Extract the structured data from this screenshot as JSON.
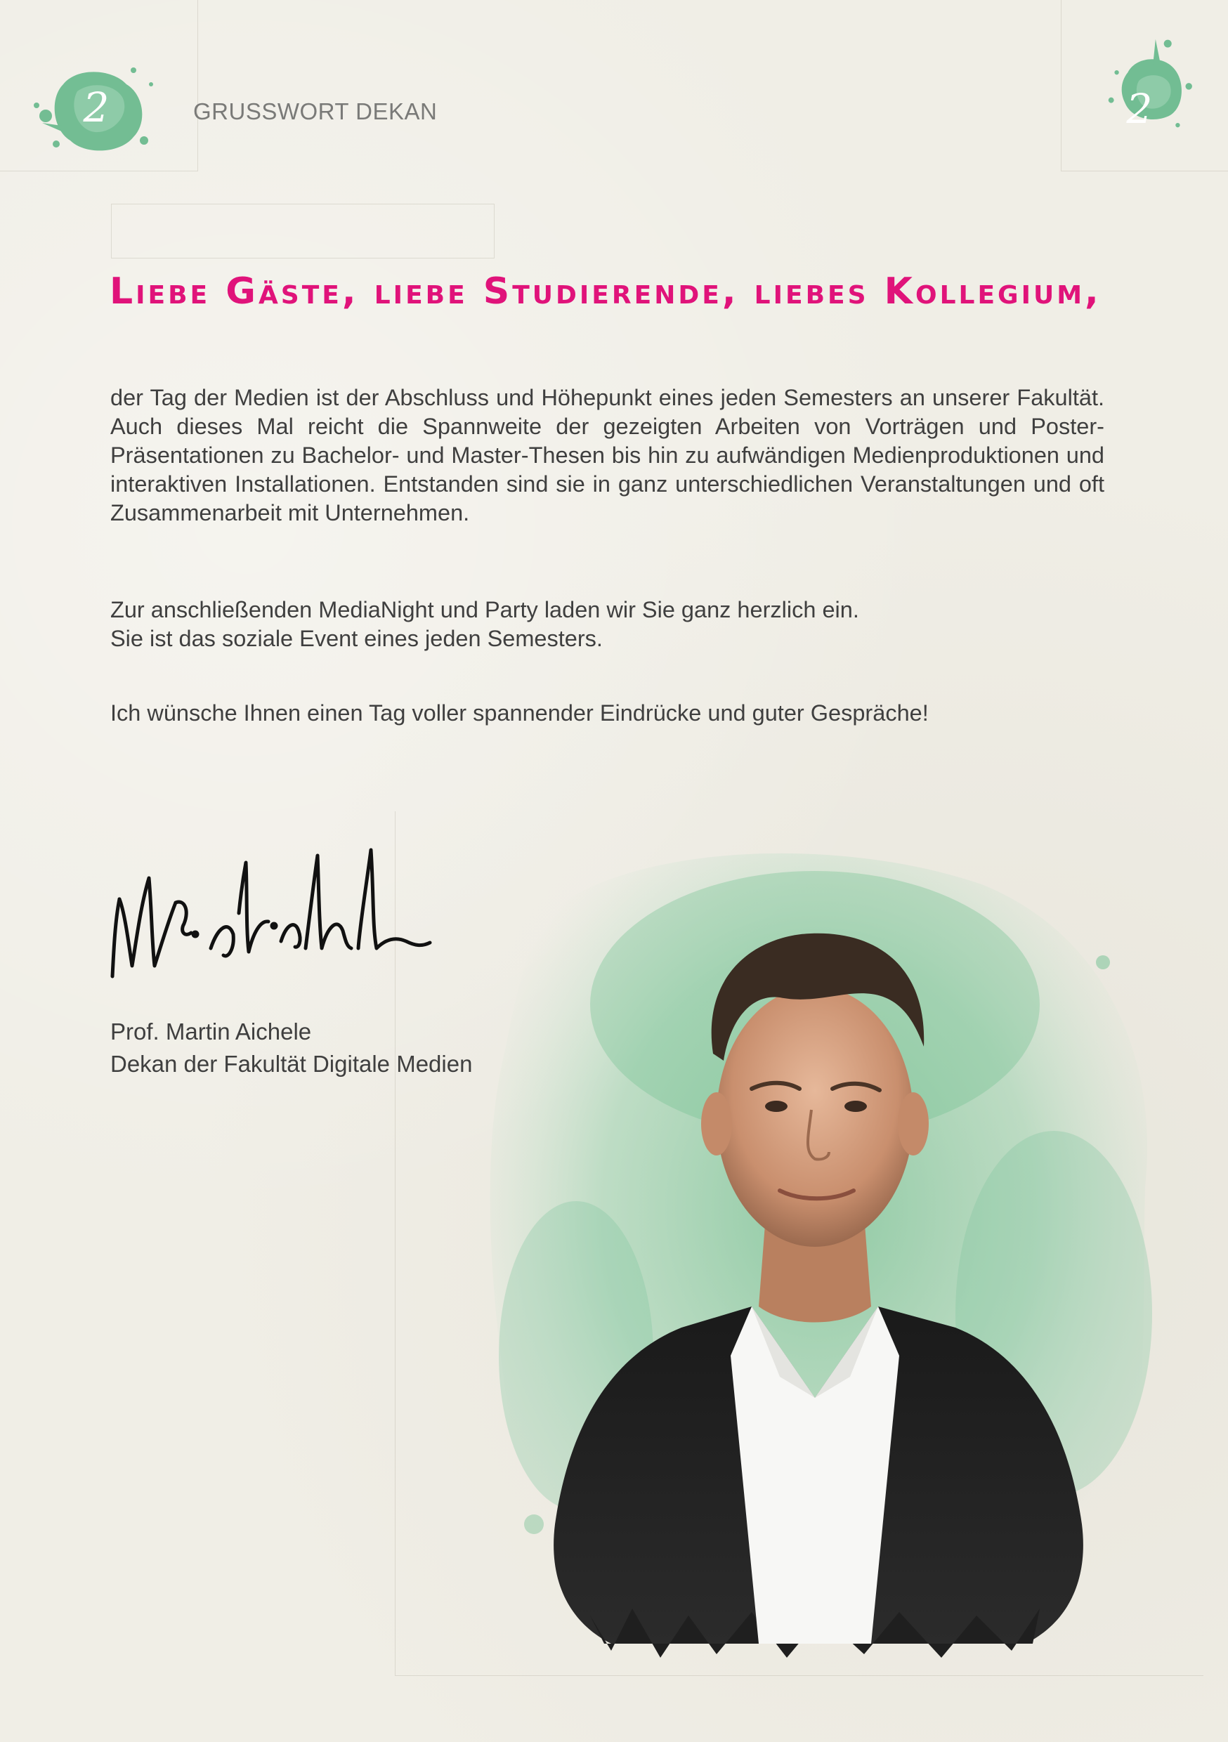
{
  "header": {
    "page_number_left": "2",
    "page_number_right": "2",
    "section_label": "GRUSSWORT DEKAN",
    "blob_color": "#5db585"
  },
  "letter": {
    "headline": "Liebe Gäste, liebe Studierende, liebes Kollegium,",
    "headline_color": "#e0137a",
    "paragraphs": [
      "der Tag der Medien ist der Abschluss und Höhepunkt eines jeden Semesters an unserer Fakultät. Auch dieses Mal reicht die Spannweite der gezeigten Arbeiten von Vorträgen und Poster-Präsentationen zu Bachelor- und Master-Thesen bis hin zu aufwändigen Medienproduktionen und interaktiven Installationen. Entstanden sind sie in ganz unterschiedlichen Veranstaltungen und oft Zusammenarbeit mit Unternehmen.",
      "Zur anschließenden MediaNight und Party laden wir Sie ganz herzlich ein.\nSie ist das soziale Event eines jeden Semesters.",
      "Ich wünsche Ihnen einen Tag voller spannender Eindrücke und guter Gespräche!"
    ]
  },
  "signatory": {
    "name": "Prof. Martin Aichele",
    "role": "Dekan der Fakultät Digitale Medien",
    "signature_image": "handwritten-signature"
  },
  "portrait": {
    "image": "portrait-photo-with-watercolor-background",
    "wash_color": "#6fbf8f"
  }
}
